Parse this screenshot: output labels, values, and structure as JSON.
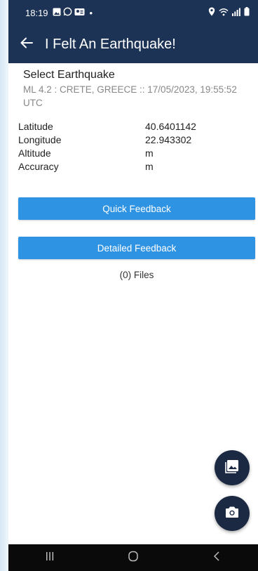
{
  "status_bar": {
    "time": "18:19",
    "dot": "•",
    "left_icons": [
      "image-icon",
      "whatsapp-icon",
      "contact-icon"
    ],
    "right_icons": [
      "location-icon",
      "wifi-icon",
      "signal-icon",
      "battery-icon"
    ]
  },
  "app_bar": {
    "title": "I Felt An Earthquake!",
    "back_icon": "arrow-left-icon"
  },
  "select_earthquake": {
    "label": "Select Earthquake",
    "value": "ML 4.2 : CRETE, GREECE :: 17/05/2023, 19:55:52 UTC"
  },
  "location": {
    "rows": [
      {
        "label": "Latitude",
        "value": "40.6401142"
      },
      {
        "label": "Longitude",
        "value": "22.943302"
      },
      {
        "label": "Altitude",
        "value": "m"
      },
      {
        "label": "Accuracy",
        "value": "m"
      }
    ]
  },
  "buttons": {
    "quick": "Quick Feedback",
    "detailed": "Detailed Feedback"
  },
  "files_text": "(0) Files",
  "fabs": {
    "gallery_icon": "image-icon",
    "camera_icon": "camera-icon"
  },
  "nav_bar": {
    "icons": [
      "recents-icon",
      "home-icon",
      "back-icon"
    ]
  },
  "colors": {
    "app_bar": "#1c3356",
    "button": "#2f93e3",
    "fab": "#1c2942",
    "nav_bar": "#0a0a0a"
  }
}
